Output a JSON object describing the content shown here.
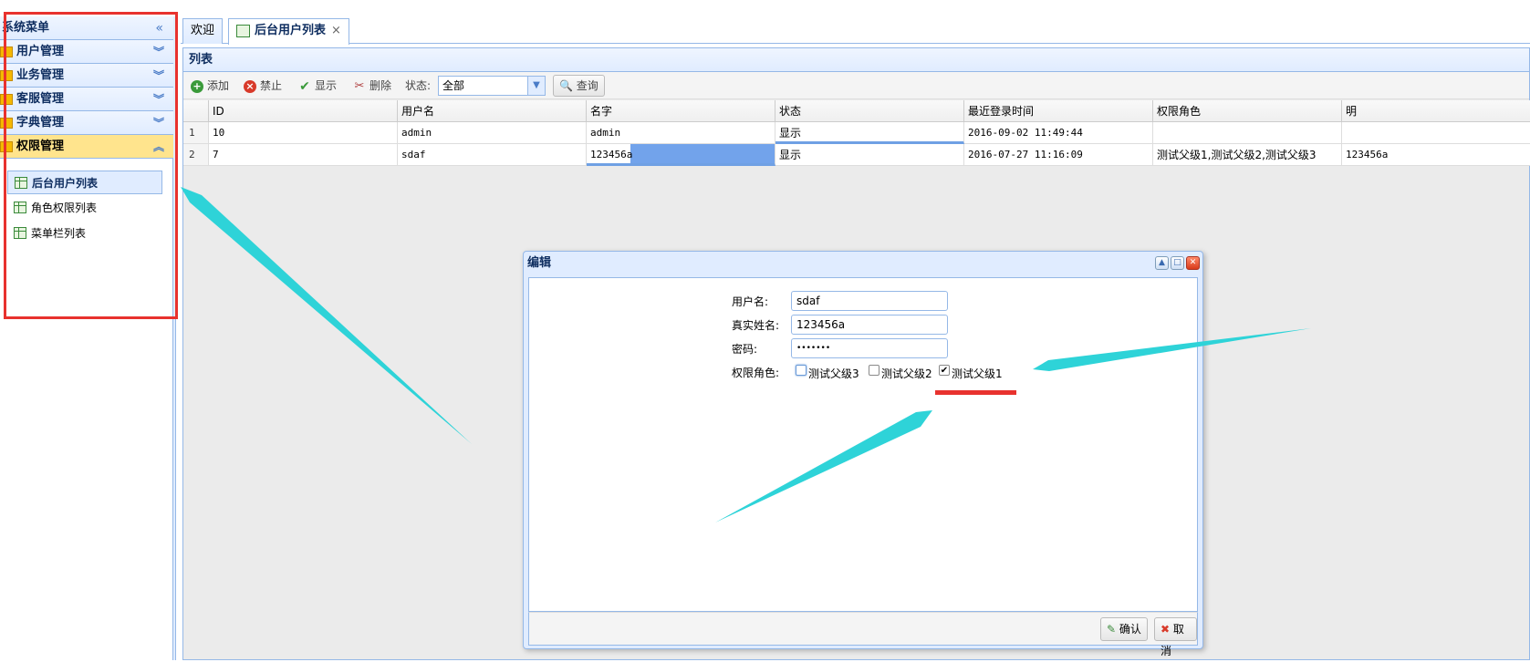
{
  "sidebar": {
    "title": "系统菜单",
    "collapse_icon": "«",
    "sections": [
      {
        "label": "用户管理",
        "chevron": "︾"
      },
      {
        "label": "业务管理",
        "chevron": "︾"
      },
      {
        "label": "客服管理",
        "chevron": "︾"
      },
      {
        "label": "字典管理",
        "chevron": "︾"
      },
      {
        "label": "权限管理",
        "chevron": "︽"
      }
    ],
    "items": [
      {
        "label": "后台用户列表",
        "selected": true
      },
      {
        "label": "角色权限列表"
      },
      {
        "label": "菜单栏列表"
      }
    ]
  },
  "tabs": {
    "welcome": "欢迎",
    "active": "后台用户列表",
    "close": "×"
  },
  "panel": {
    "title": "列表",
    "toolbar": {
      "add": "添加",
      "disable": "禁止",
      "show": "显示",
      "delete": "删除",
      "status_label": "状态:",
      "status_value": "全部",
      "query": "查询"
    }
  },
  "grid": {
    "columns": [
      "ID",
      "用户名",
      "名字",
      "状态",
      "最近登录时间",
      "权限角色",
      "明"
    ],
    "rows": [
      {
        "rownum": "1",
        "id": "10",
        "username": "admin",
        "name": "admin",
        "status": "显示",
        "last_login": "2016-09-02 11:49:44",
        "roles": "",
        "extra": ""
      },
      {
        "rownum": "2",
        "id": "7",
        "username": "sdaf",
        "name": "123456a",
        "status": "显示",
        "last_login": "2016-07-27 11:16:09",
        "roles": "测试父级1,测试父级2,测试父级3",
        "extra": "123456a"
      }
    ]
  },
  "dialog": {
    "title": "编辑",
    "fields": {
      "username_label": "用户名:",
      "username_value": "sdaf",
      "realname_label": "真实姓名:",
      "realname_value": "123456a",
      "password_label": "密码:",
      "password_value": "•••••••",
      "roles_label": "权限角色:",
      "roles": [
        {
          "label": "测试父级3",
          "checked": false
        },
        {
          "label": "测试父级2",
          "checked": false
        },
        {
          "label": "测试父级1",
          "checked": true
        }
      ]
    },
    "confirm": "确认",
    "cancel": "取消"
  },
  "colors": {
    "accent": "#95b8e7",
    "annotation_red": "#e8322e",
    "annotation_arrow": "#2ed3d8",
    "active_section": "#ffe48d"
  }
}
